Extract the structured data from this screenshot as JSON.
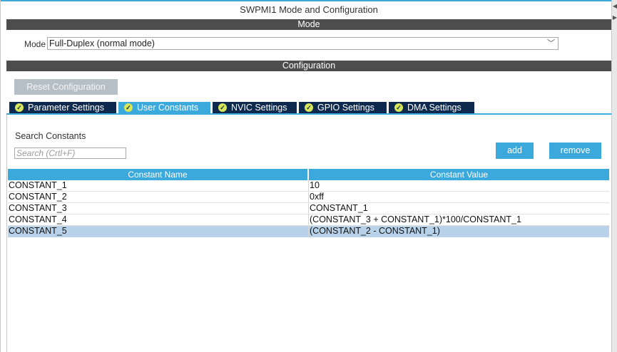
{
  "window": {
    "title": "SWPMI1 Mode and Configuration"
  },
  "mode_section": {
    "header": "Mode",
    "label": "Mode",
    "selected_value": "Full-Duplex (normal mode)"
  },
  "config_section": {
    "header": "Configuration",
    "reset_label": "Reset Configuration"
  },
  "tabs": [
    {
      "label": "Parameter Settings",
      "active": false
    },
    {
      "label": "User Constants",
      "active": true
    },
    {
      "label": "NVIC Settings",
      "active": false
    },
    {
      "label": "GPIO Settings",
      "active": false
    },
    {
      "label": "DMA Settings",
      "active": false
    }
  ],
  "constants_panel": {
    "search_label": "Search Constants",
    "search_placeholder": "Search (Crtl+F)",
    "add_label": "add",
    "remove_label": "remove",
    "columns": [
      "Constant Name",
      "Constant Value"
    ],
    "rows": [
      {
        "name": "CONSTANT_1",
        "value": "10"
      },
      {
        "name": "CONSTANT_2",
        "value": "0xff"
      },
      {
        "name": "CONSTANT_3",
        "value": "CONSTANT_1"
      },
      {
        "name": "CONSTANT_4",
        "value": "(CONSTANT_3 + CONSTANT_1)*100/CONSTANT_1"
      },
      {
        "name": "CONSTANT_5",
        "value": "(CONSTANT_2 - CONSTANT_1)"
      }
    ],
    "selected_row": "CONSTANT_5"
  },
  "colors": {
    "accent": "#3ca9dc",
    "tab_dark": "#0d2a4e",
    "section_bar": "#4d4d4d",
    "selected_row": "#b8d2ea",
    "check": "#d8e65a"
  }
}
